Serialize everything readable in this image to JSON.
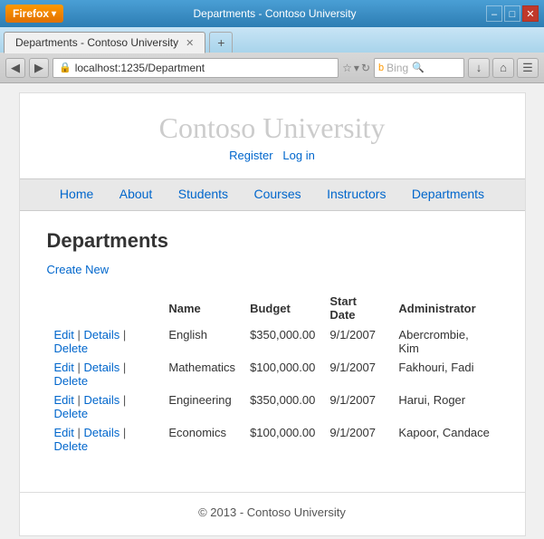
{
  "window": {
    "title": "Departments - Contoso University",
    "firefox_label": "Firefox",
    "minimize": "–",
    "maximize": "□",
    "close": "✕",
    "tab_add": "+",
    "url": "localhost:1235/Department",
    "search_placeholder": "Bing"
  },
  "site": {
    "title": "Contoso University",
    "register_label": "Register",
    "login_label": "Log in",
    "nav_items": [
      "Home",
      "About",
      "Students",
      "Courses",
      "Instructors",
      "Departments"
    ]
  },
  "main": {
    "heading": "Departments",
    "create_new": "Create New",
    "table": {
      "columns": [
        "Name",
        "Budget",
        "Start Date",
        "Administrator"
      ],
      "rows": [
        {
          "name": "English",
          "budget": "$350,000.00",
          "start_date": "9/1/2007",
          "admin": "Abercrombie, Kim"
        },
        {
          "name": "Mathematics",
          "budget": "$100,000.00",
          "start_date": "9/1/2007",
          "admin": "Fakhouri, Fadi"
        },
        {
          "name": "Engineering",
          "budget": "$350,000.00",
          "start_date": "9/1/2007",
          "admin": "Harui, Roger"
        },
        {
          "name": "Economics",
          "budget": "$100,000.00",
          "start_date": "9/1/2007",
          "admin": "Kapoor, Candace"
        }
      ]
    }
  },
  "footer": {
    "text": "© 2013 - Contoso University"
  }
}
